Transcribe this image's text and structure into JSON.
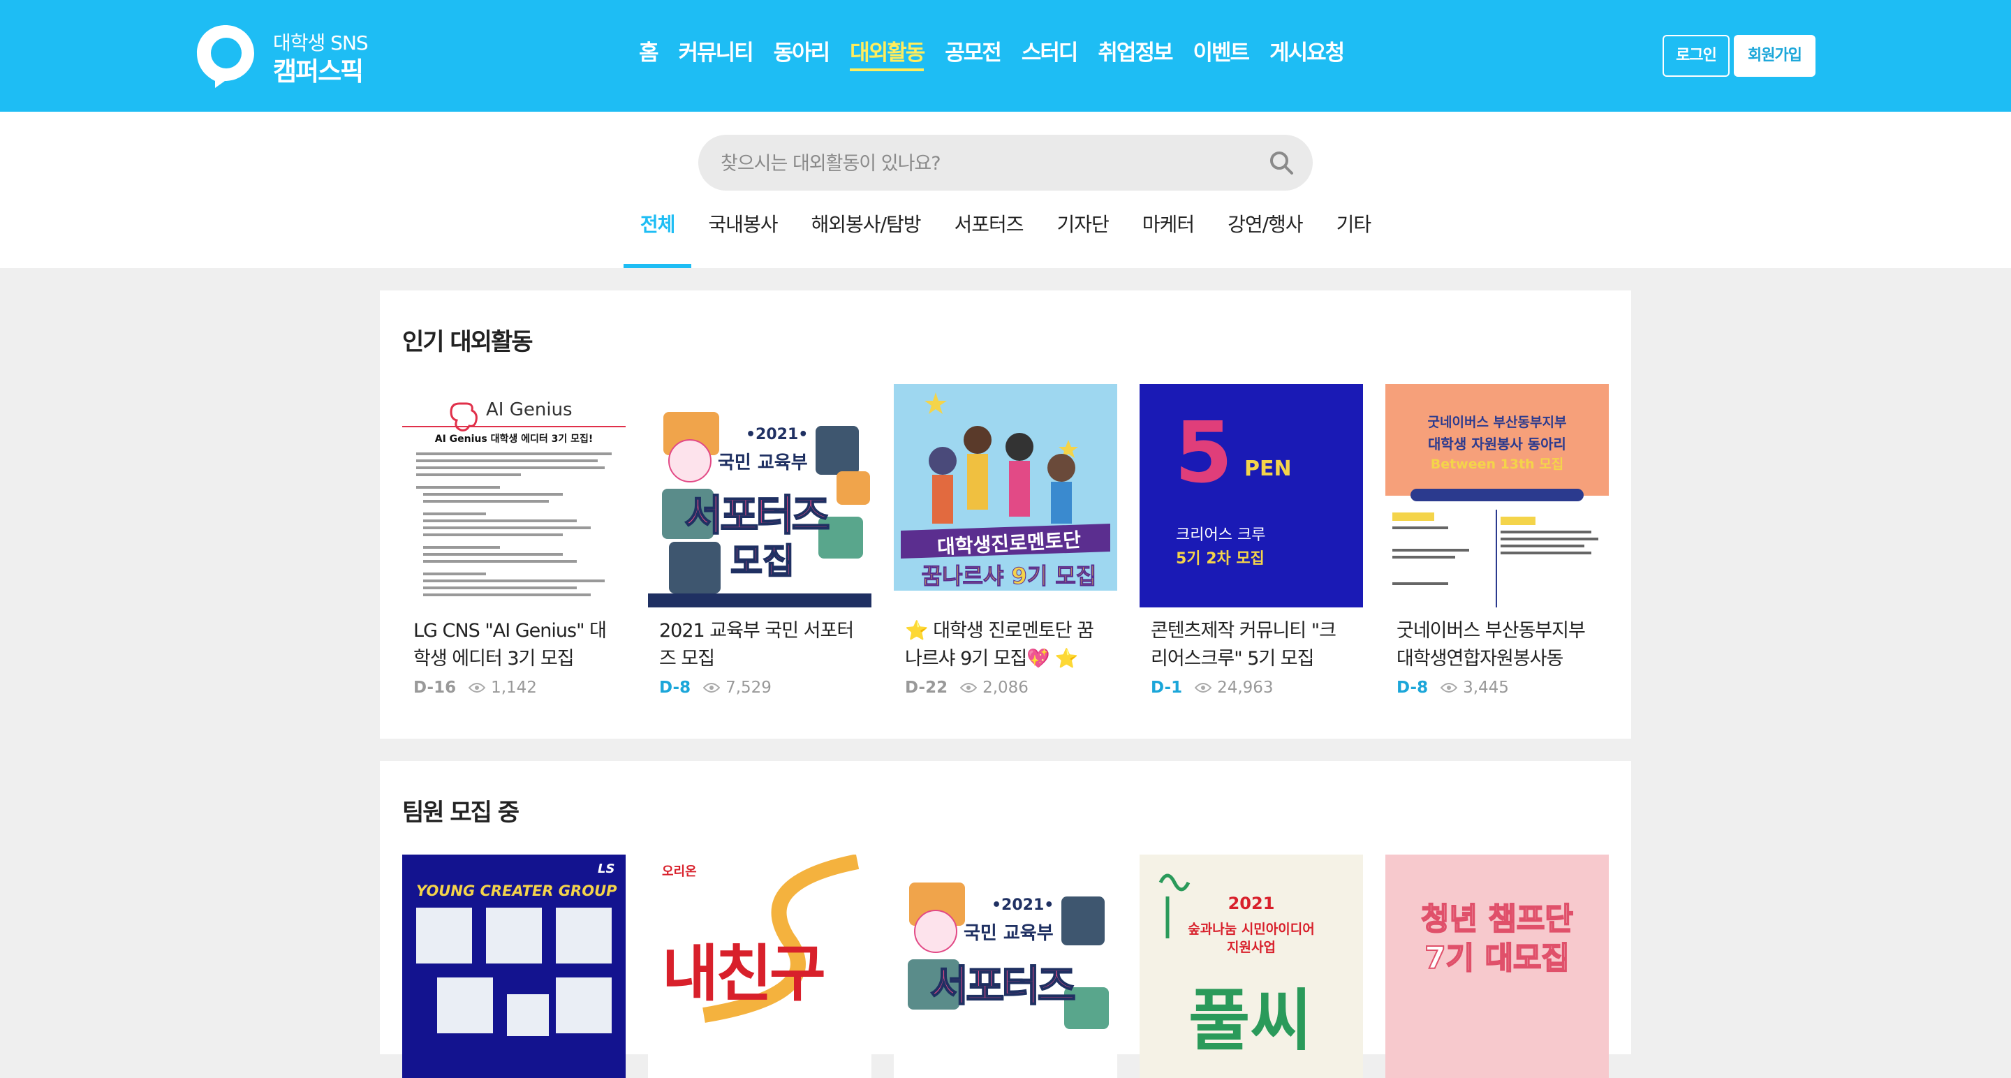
{
  "brand": {
    "subtitle": "대학생 SNS",
    "name": "캠퍼스픽"
  },
  "nav": {
    "items": [
      "홈",
      "커뮤니티",
      "동아리",
      "대외활동",
      "공모전",
      "스터디",
      "취업정보",
      "이벤트",
      "게시요청"
    ],
    "active_index": 3
  },
  "auth": {
    "login": "로그인",
    "signup": "회원가입"
  },
  "search": {
    "placeholder": "찾으시는 대외활동이 있나요?"
  },
  "categories": {
    "items": [
      "전체",
      "국내봉사",
      "해외봉사/탐방",
      "서포터즈",
      "기자단",
      "마케터",
      "강연/행사",
      "기타"
    ],
    "active_index": 0
  },
  "popular": {
    "title": "인기 대외활동",
    "cards": [
      {
        "title": "LG CNS \"AI Genius\" 대학생 에디터 3기 모집",
        "dday": "D-16",
        "views": "1,142",
        "poster_text": "AI Genius",
        "poster_sub": "AI Genius 대학생 에디터 3기 모집!"
      },
      {
        "title": "2021 교육부 국민 서포터즈 모집",
        "dday": "D-8",
        "views": "7,529",
        "poster_text": "서포터즈",
        "poster_sub": "국민 교육부",
        "poster_year": "•2021•",
        "poster_bottom": "모집"
      },
      {
        "title": "⭐ 대학생 진로멘토단 꿈나르샤 9기 모집💖 ⭐",
        "dday": "D-22",
        "views": "2,086",
        "poster_text": "대학생진로멘토단",
        "poster_sub": "꿈나르샤 9기 모집"
      },
      {
        "title": "콘텐츠제작 커뮤니티 \"크리어스크루\" 5기 모집",
        "dday": "D-1",
        "views": "24,963",
        "poster_text": "5",
        "poster_sub": "PEN",
        "poster_line1": "크리어스 크루",
        "poster_line2": "5기 2차 모집"
      },
      {
        "title": "굿네이버스 부산동부지부 대학생연합자원봉사동아…",
        "dday": "D-8",
        "views": "3,445",
        "poster_text": "굿네이버스 부산동부지부",
        "poster_sub": "대학생 자원봉사 동아리",
        "poster_line1": "Between 13th 모집"
      }
    ]
  },
  "recruiting": {
    "title": "팀원 모집 중",
    "cards": [
      {
        "poster_text": "YOUNG CREATER GROUP",
        "poster_sub": "LS"
      },
      {
        "poster_text": "내친구",
        "poster_sub": "오리온"
      },
      {
        "poster_text": "서포터즈",
        "poster_sub": "국민 교육부",
        "poster_year": "•2021•"
      },
      {
        "poster_text": "풀씨",
        "poster_sub": "2021",
        "poster_line1": "숲과나눔 시민아이디어",
        "poster_line2": "지원사업"
      },
      {
        "poster_text": "청년 챔프단",
        "poster_sub": "7기 대모집"
      }
    ]
  },
  "colors": {
    "brand": "#1ebdf4",
    "active_nav": "#ffed5c",
    "dday_hot": "#1ba6d9"
  }
}
